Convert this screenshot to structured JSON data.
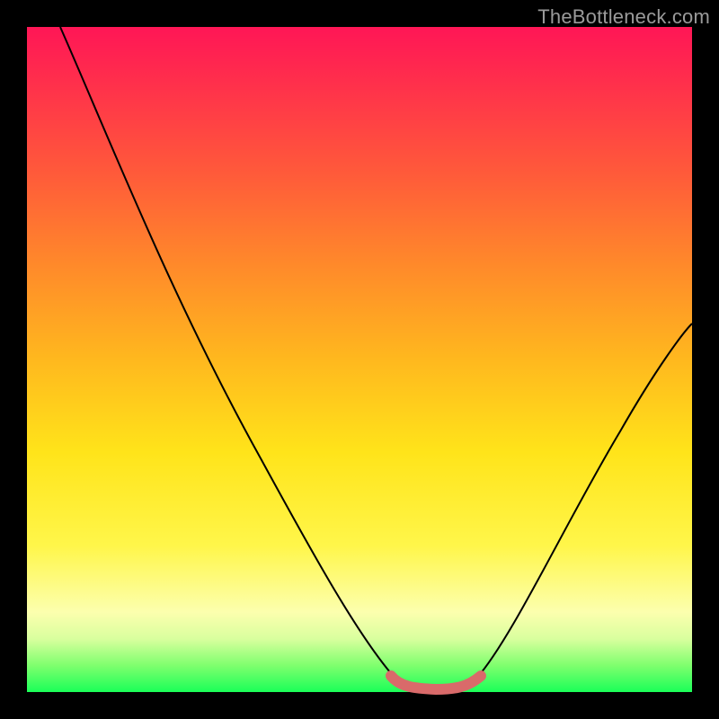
{
  "attribution": "TheBottleneck.com",
  "chart_data": {
    "type": "line",
    "title": "",
    "xlabel": "",
    "ylabel": "",
    "xlim": [
      0,
      1
    ],
    "ylim": [
      0,
      1
    ],
    "grid": false,
    "legend": false,
    "background_gradient": [
      "#ff1656",
      "#ff5a3a",
      "#ffb81e",
      "#fff64a",
      "#fcffae",
      "#1aff58"
    ],
    "series": [
      {
        "name": "curve-left",
        "stroke": "#000000",
        "stroke_width": 2,
        "x": [
          0.05,
          0.15,
          0.25,
          0.35,
          0.45,
          0.52,
          0.56
        ],
        "y": [
          1.0,
          0.83,
          0.64,
          0.44,
          0.22,
          0.08,
          0.02
        ]
      },
      {
        "name": "curve-right",
        "stroke": "#000000",
        "stroke_width": 2,
        "x": [
          0.67,
          0.72,
          0.8,
          0.88,
          0.96,
          1.0
        ],
        "y": [
          0.02,
          0.07,
          0.17,
          0.3,
          0.44,
          0.52
        ]
      },
      {
        "name": "flat-bottom-highlight",
        "stroke": "#d96a6a",
        "stroke_width": 10,
        "x": [
          0.55,
          0.58,
          0.62,
          0.66,
          0.68
        ],
        "y": [
          0.015,
          0.005,
          0.004,
          0.006,
          0.015
        ]
      }
    ],
    "annotations": []
  }
}
